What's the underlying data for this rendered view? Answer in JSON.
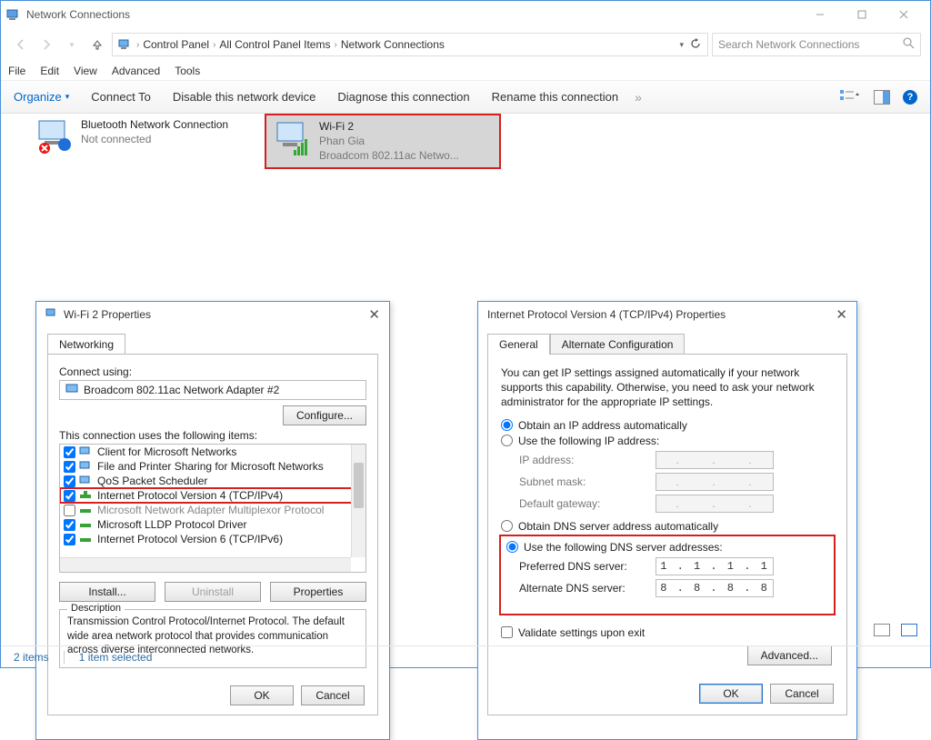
{
  "window": {
    "title": "Network Connections",
    "sys_buttons": [
      "minimize",
      "maximize",
      "close"
    ]
  },
  "breadcrumb": {
    "items": [
      "Control Panel",
      "All Control Panel Items",
      "Network Connections"
    ]
  },
  "search": {
    "placeholder": "Search Network Connections"
  },
  "menubar": [
    "File",
    "Edit",
    "View",
    "Advanced",
    "Tools"
  ],
  "cmdbar": {
    "organize": "Organize",
    "cmds": [
      "Connect To",
      "Disable this network device",
      "Diagnose this connection",
      "Rename this connection"
    ]
  },
  "connections": [
    {
      "title": "Bluetooth Network Connection",
      "sub1": "Not connected",
      "sub2": ""
    },
    {
      "title": "Wi-Fi 2",
      "sub1": "Phan Gia",
      "sub2": "Broadcom 802.11ac Netwo..."
    }
  ],
  "statusbar": {
    "count": "2 items",
    "selected": "1 item selected"
  },
  "dlg1": {
    "title": "Wi-Fi 2 Properties",
    "tab": "Networking",
    "connect_using_label": "Connect using:",
    "adapter": "Broadcom 802.11ac Network Adapter #2",
    "configure": "Configure...",
    "items_label": "This connection uses the following items:",
    "items": [
      {
        "checked": true,
        "label": "Client for Microsoft Networks"
      },
      {
        "checked": true,
        "label": "File and Printer Sharing for Microsoft Networks"
      },
      {
        "checked": true,
        "label": "QoS Packet Scheduler"
      },
      {
        "checked": true,
        "label": "Internet Protocol Version 4 (TCP/IPv4)"
      },
      {
        "checked": false,
        "label": "Microsoft Network Adapter Multiplexor Protocol"
      },
      {
        "checked": true,
        "label": "Microsoft LLDP Protocol Driver"
      },
      {
        "checked": true,
        "label": "Internet Protocol Version 6 (TCP/IPv6)"
      }
    ],
    "install": "Install...",
    "uninstall": "Uninstall",
    "properties": "Properties",
    "desc_label": "Description",
    "desc": "Transmission Control Protocol/Internet Protocol. The default wide area network protocol that provides communication across diverse interconnected networks.",
    "ok": "OK",
    "cancel": "Cancel"
  },
  "dlg2": {
    "title": "Internet Protocol Version 4 (TCP/IPv4) Properties",
    "tabs": [
      "General",
      "Alternate Configuration"
    ],
    "info": "You can get IP settings assigned automatically if your network supports this capability. Otherwise, you need to ask your network administrator for the appropriate IP settings.",
    "ip_auto": "Obtain an IP address automatically",
    "ip_manual": "Use the following IP address:",
    "ip_fields": {
      "ip": "IP address:",
      "mask": "Subnet mask:",
      "gw": "Default gateway:"
    },
    "dns_auto": "Obtain DNS server address automatically",
    "dns_manual": "Use the following DNS server addresses:",
    "dns_fields": {
      "pref": {
        "label": "Preferred DNS server:",
        "value": "1 . 1 . 1 . 1"
      },
      "alt": {
        "label": "Alternate DNS server:",
        "value": "8 . 8 . 8 . 8"
      }
    },
    "validate": "Validate settings upon exit",
    "advanced": "Advanced...",
    "ok": "OK",
    "cancel": "Cancel"
  }
}
